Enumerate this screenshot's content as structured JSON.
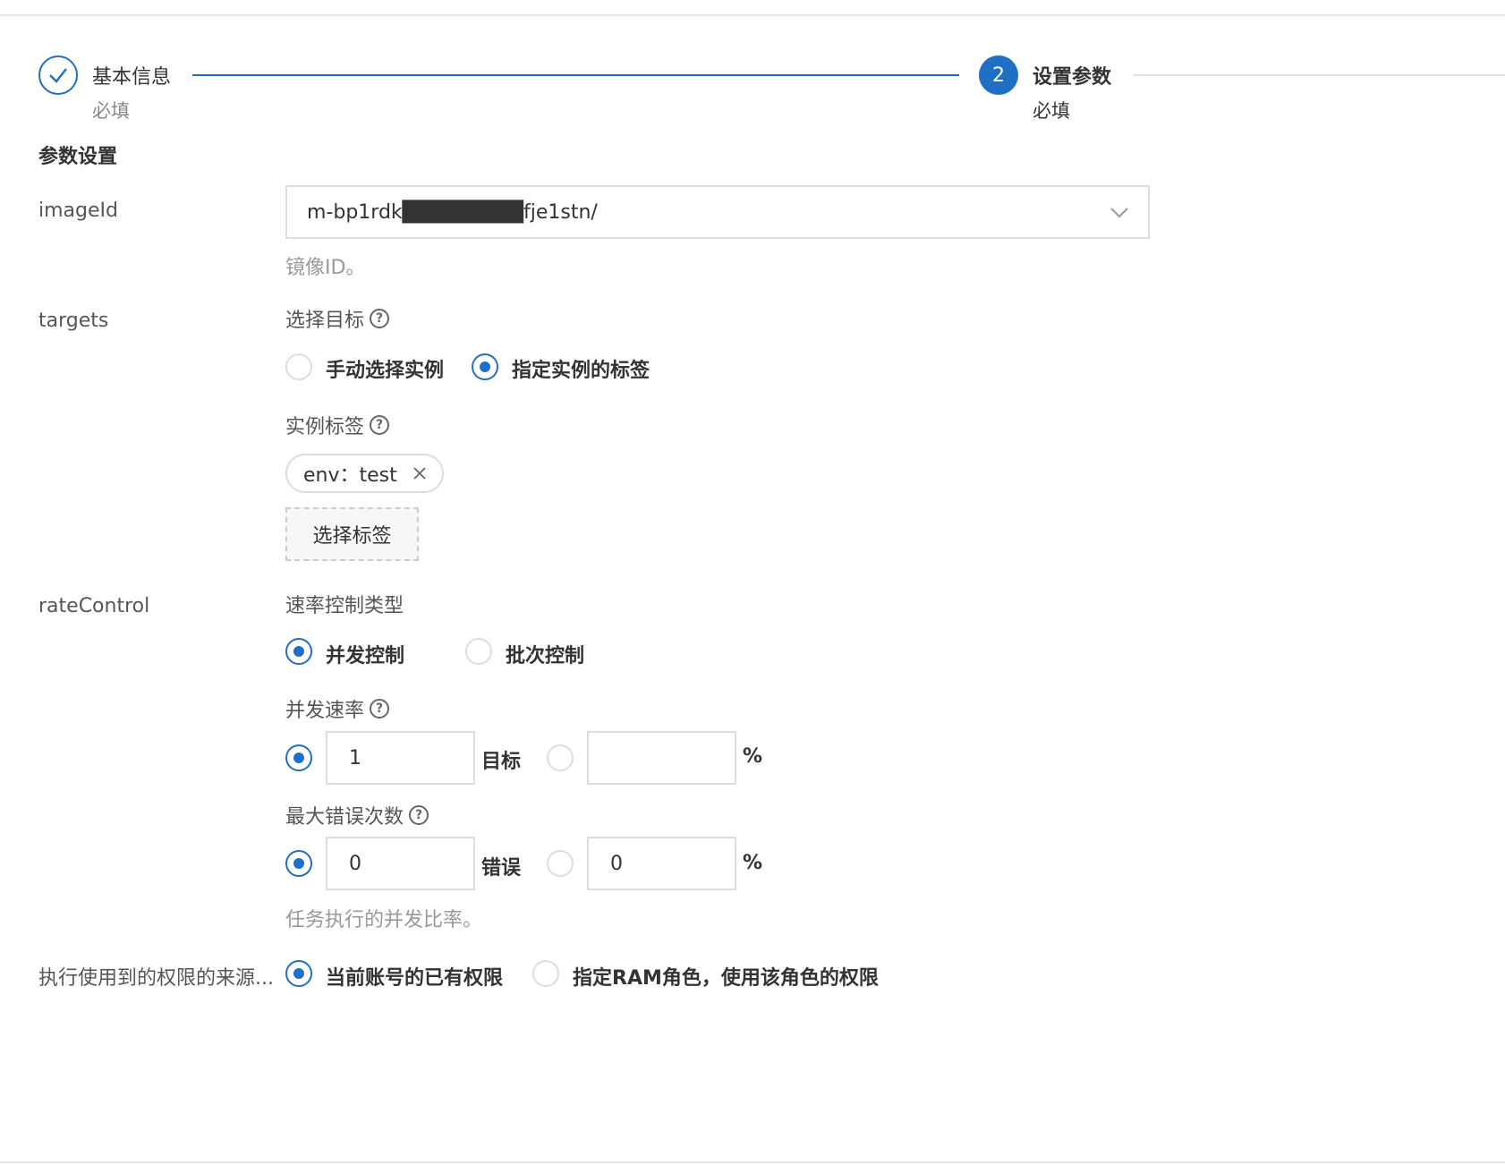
{
  "steps": [
    {
      "title": "基本信息",
      "desc": "必填"
    },
    {
      "number": "2",
      "title": "设置参数",
      "desc": "必填"
    }
  ],
  "section_title": "参数设置",
  "imageId": {
    "label": "imageId",
    "value": "m-bp1rdk████████fje1stn/",
    "hint": "镜像ID。"
  },
  "targets": {
    "label": "targets",
    "select_label": "选择目标",
    "options": [
      "手动选择实例",
      "指定实例的标签"
    ],
    "selected": "指定实例的标签",
    "tags_label": "实例标签",
    "tag": "env：test",
    "select_tags_button": "选择标签"
  },
  "rateControl": {
    "label": "rateControl",
    "type_label": "速率控制类型",
    "type_options": [
      "并发控制",
      "批次控制"
    ],
    "type_selected": "并发控制",
    "concurrency_label": "并发速率",
    "concurrency_value": "1",
    "concurrency_unit": "目标",
    "concurrency_percent_value": "",
    "percent_unit": "%",
    "max_errors_label": "最大错误次数",
    "max_errors_value": "0",
    "max_errors_unit": "错误",
    "max_errors_percent_value": "0",
    "hint": "任务执行的并发比率。"
  },
  "permission": {
    "label": "执行使用到的权限的来源...",
    "options": [
      "当前账号的已有权限",
      "指定RAM角色，使用该角色的权限"
    ],
    "selected": "当前账号的已有权限"
  },
  "colors": {
    "accent": "#1f6fc5",
    "border": "#dddddd",
    "hint": "#999999"
  }
}
